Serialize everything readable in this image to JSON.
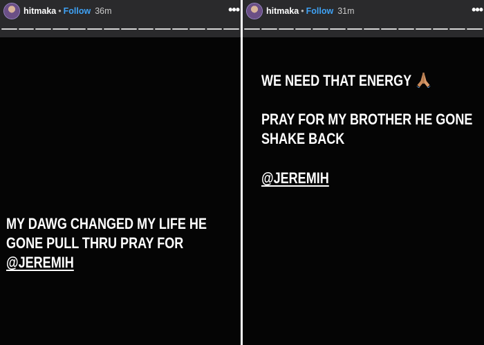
{
  "stories": [
    {
      "username": "hitmaka",
      "separator": "•",
      "follow_label": "Follow",
      "time": "36m",
      "more_label": "•••",
      "progress_segments": 14,
      "text_lines": [
        "MY DAWG CHANGED MY LIFE HE",
        "GONE PULL THRU PRAY FOR"
      ],
      "mention": "@JEREMIH"
    },
    {
      "username": "hitmaka",
      "separator": "•",
      "follow_label": "Follow",
      "time": "31m",
      "more_label": "•••",
      "progress_segments": 14,
      "energy_text": "WE NEED THAT ENERGY",
      "energy_emoji": "pray-hands-emoji",
      "text_lines": [
        "PRAY FOR MY BROTHER HE GONE",
        "SHAKE BACK"
      ],
      "mention": "@JEREMIH"
    }
  ],
  "colors": {
    "background": "#050505",
    "header": "#2a2a2c",
    "follow": "#3fa2f5",
    "text": "#ffffff"
  }
}
